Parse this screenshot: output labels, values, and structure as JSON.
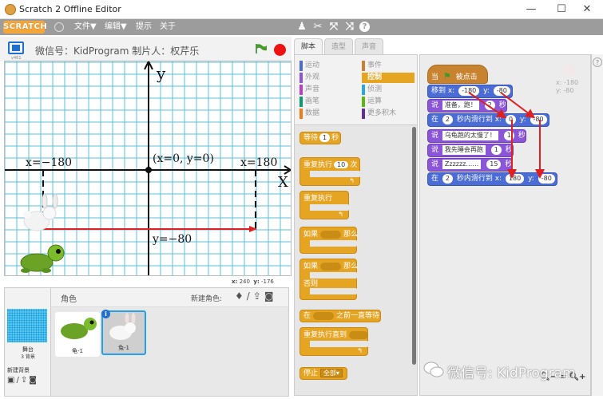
{
  "window": {
    "title": "Scratch 2 Offline Editor",
    "controls": [
      "minimize",
      "maximize",
      "close"
    ]
  },
  "menubar": {
    "logo": "SCRATCH",
    "items": [
      "文件▼",
      "编辑▼",
      "提示",
      "关于"
    ],
    "tools": [
      "duplicate-stamp-icon",
      "delete-cut-icon",
      "grow-icon",
      "shrink-icon",
      "help-icon"
    ]
  },
  "stage_header": {
    "version": "v461",
    "project_title": "微信号：KidProgram  制片人：权芹乐"
  },
  "stage": {
    "axis_labels": {
      "y": "y",
      "x": "X"
    },
    "annotations": {
      "left_x": "x=−180",
      "right_x": "x=180",
      "origin": "(x=0, y=0)",
      "y_line": "y=−80"
    },
    "sprites_on_stage": [
      "rabbit",
      "turtle"
    ]
  },
  "mouse_readout": {
    "x_label": "x:",
    "x": "240",
    "y_label": "y:",
    "y": "-176"
  },
  "sprite_pane": {
    "header_label": "角色",
    "new_sprite_label": "新建角色:",
    "new_sprite_tools": [
      "choose-from-library-icon",
      "paint-icon",
      "upload-icon",
      "camera-icon"
    ],
    "stage_thumb": {
      "label": "舞台",
      "sub": "3 背景"
    },
    "new_backdrop_label": "新建背景",
    "new_backdrop_tools": [
      "backdrop-library-icon",
      "paint-icon",
      "upload-icon",
      "camera-icon"
    ],
    "sprites": [
      {
        "name": "龟-1",
        "selected": false
      },
      {
        "name": "兔-1",
        "selected": true
      }
    ]
  },
  "tabs": [
    {
      "label": "脚本",
      "active": true
    },
    {
      "label": "造型",
      "active": false
    },
    {
      "label": "声音",
      "active": false
    }
  ],
  "categories": [
    {
      "label": "运动",
      "color": "#4a6cd4",
      "active": false
    },
    {
      "label": "外观",
      "color": "#8a55d7",
      "active": false
    },
    {
      "label": "声音",
      "color": "#bb42c3",
      "active": false
    },
    {
      "label": "画笔",
      "color": "#0e9a6c",
      "active": false
    },
    {
      "label": "数据",
      "color": "#ee7d16",
      "active": false
    },
    {
      "label": "事件",
      "color": "#c88330",
      "active": false
    },
    {
      "label": "控制",
      "color": "#e6a423",
      "active": true
    },
    {
      "label": "侦测",
      "color": "#2ca5e2",
      "active": false
    },
    {
      "label": "运算",
      "color": "#5cb712",
      "active": false
    },
    {
      "label": "更多积木",
      "color": "#632d99",
      "active": false
    }
  ],
  "palette_blocks": {
    "wait": {
      "pre": "等待",
      "value": "1",
      "post": "秒"
    },
    "repeat": {
      "pre": "重复执行",
      "value": "10",
      "post": "次"
    },
    "forever": {
      "label": "重复执行"
    },
    "if_then": {
      "pre": "如果",
      "post": "那么"
    },
    "if_else": {
      "pre": "如果",
      "post": "那么",
      "else": "否则"
    },
    "wait_until": {
      "pre": "在",
      "post": "之前一直等待"
    },
    "repeat_until": {
      "pre": "重复执行直到"
    },
    "stop": {
      "pre": "停止",
      "option": "全部"
    }
  },
  "script": {
    "hat": {
      "pre": "当",
      "post": "被点击"
    },
    "blocks": [
      {
        "type": "motion",
        "parts": [
          "移到 x:",
          {
            "v": "-180"
          },
          "y:",
          {
            "v": "-80"
          }
        ]
      },
      {
        "type": "looks",
        "parts": [
          "说",
          {
            "t": "准备，跑！"
          },
          {
            "v": "2"
          },
          "秒"
        ]
      },
      {
        "type": "motion",
        "parts": [
          "在",
          {
            "v": "2"
          },
          "秒内滑行到 x:",
          {
            "v": "0"
          },
          "y:",
          {
            "v": "-80"
          }
        ]
      },
      {
        "type": "looks",
        "parts": [
          "说",
          {
            "t": "乌龟跑的太慢了！"
          },
          {
            "v": "1"
          },
          "秒"
        ]
      },
      {
        "type": "looks",
        "parts": [
          "说",
          {
            "t": "我先睡会再跑"
          },
          {
            "v": "1"
          },
          "秒"
        ]
      },
      {
        "type": "looks",
        "parts": [
          "说",
          {
            "t": "Zzzzzz……"
          },
          {
            "v": "15"
          },
          "秒"
        ]
      },
      {
        "type": "motion",
        "parts": [
          "在",
          {
            "v": "2"
          },
          "秒内滑行到 x:",
          {
            "v": "180"
          },
          "y:",
          {
            "v": "-80"
          }
        ]
      }
    ]
  },
  "sprite_info": {
    "x_label": "x:",
    "x": "-180",
    "y_label": "y:",
    "y": "-80"
  },
  "zoom_controls": [
    "zoom-out-icon",
    "reset-zoom-icon",
    "zoom-in-icon"
  ],
  "watermark": "微信号: KidProgram",
  "colors": {
    "menubar": "#9c9c9c",
    "control": "#e6a423",
    "motion": "#4a6cd4",
    "looks": "#8a55d7",
    "event": "#c88330",
    "grid": "#5bc0d8",
    "annotation_arrow": "#e02020"
  }
}
